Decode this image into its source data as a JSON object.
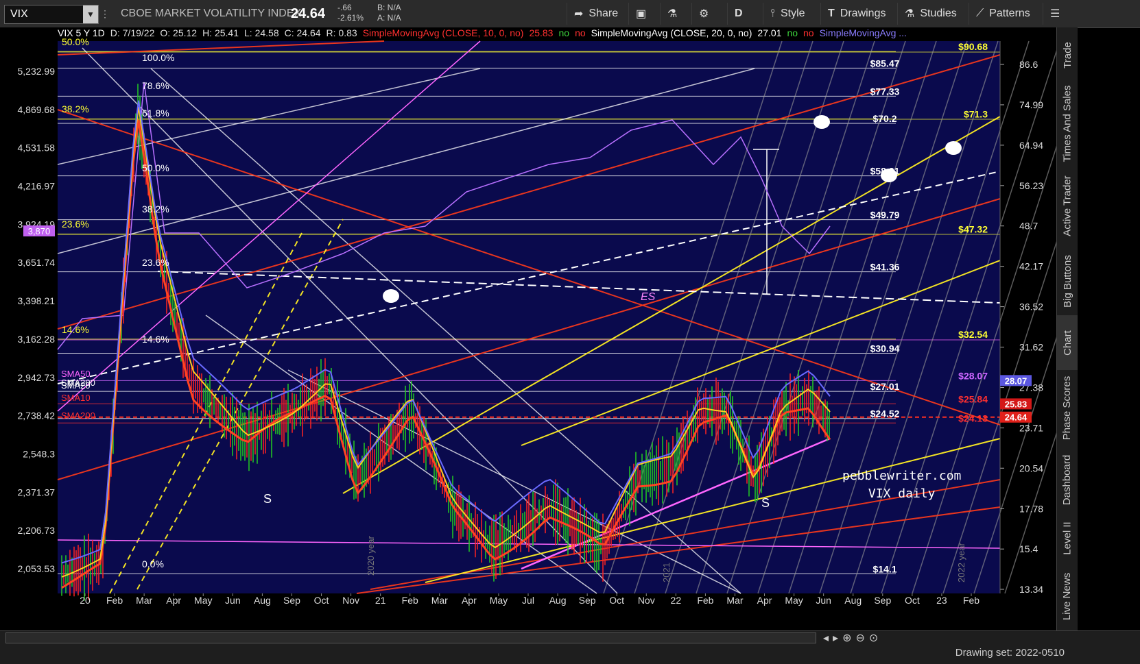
{
  "toolbar": {
    "symbol": "VIX",
    "name": "CBOE MARKET VOLATILITY INDEX",
    "last": "24.64",
    "change": "-.66",
    "change_pct": "-2.61%",
    "bid": "B: N/A",
    "ask": "A: N/A",
    "share": "Share",
    "period_label": "D",
    "style": "Style",
    "drawings": "Drawings",
    "studies": "Studies",
    "patterns": "Patterns"
  },
  "header": {
    "title": "VIX 5 Y 1D",
    "date": "D: 7/19/22",
    "open": "O: 25.12",
    "high": "H: 25.41",
    "low": "L: 24.58",
    "close": "C: 24.64",
    "range": "R: 0.83",
    "sma10": "SimpleMovingAvg (CLOSE, 10, 0, no)",
    "sma10_val": "25.83",
    "no1": "no",
    "no2": "no",
    "sma20": "SimpleMovingAvg (CLOSE, 20, 0, no)",
    "sma20_val": "27.01",
    "no3": "no",
    "no4": "no",
    "sma_more": "SimpleMovingAvg ..."
  },
  "chart_data": {
    "type": "line",
    "title": "VIX 5 Y 1D",
    "x_labels": [
      "20",
      "Feb",
      "Mar",
      "Apr",
      "May",
      "Jun",
      "Aug",
      "Sep",
      "Oct",
      "Nov",
      "21",
      "Feb",
      "Mar",
      "Apr",
      "May",
      "Jul",
      "Aug",
      "Sep",
      "Oct",
      "Nov",
      "22",
      "Feb",
      "Mar",
      "Apr",
      "May",
      "Jun",
      "Aug",
      "Sep",
      "Oct",
      "23",
      "Feb"
    ],
    "y_right_ticks": [
      86.6,
      74.99,
      64.94,
      56.23,
      48.7,
      42.17,
      36.52,
      31.62,
      27.38,
      23.71,
      20.54,
      17.78,
      15.4,
      13.34
    ],
    "y_left_ticks": [
      "5,232.99",
      "4,869.68",
      "4,531.58",
      "4,216.97",
      "3,924.19",
      "3,651.74",
      "3,398.21",
      "3,162.28",
      "2,942.73",
      "2,738.42",
      "2,548.3",
      "2,371.37",
      "2,206.73",
      "2,053.53"
    ],
    "y_scale": "log",
    "fib_left_labels": [
      "100.0%",
      "78.6%",
      "61.8%",
      "50.0%",
      "38.2%",
      "23.6%",
      "14.6%",
      "0.0%"
    ],
    "fib_far_left": [
      "50.0%",
      "38.2%",
      "23.6%",
      "14.6%"
    ],
    "level_labels": [
      "$90.68",
      "$85.47",
      "$77.33",
      "$71.3",
      "$70.2",
      "$58.21",
      "$49.79",
      "$47.32",
      "$41.36",
      "$32.54",
      "$30.94",
      "$28.07",
      "$27.01",
      "$25.84",
      "$24.52",
      "$24.13",
      "$14.1"
    ],
    "price_tags": [
      {
        "label": "28.07",
        "color": "#5b57e0"
      },
      {
        "label": "25.83",
        "color": "#d41818"
      },
      {
        "label": "24.64",
        "color": "#e0201a"
      }
    ],
    "left_tag": "3,870",
    "ma_labels": [
      "SMA50",
      "SMA200",
      "SMA20",
      "SMA10",
      "SMA200"
    ],
    "annotations": [
      "ES",
      "S",
      "S",
      "2020 year",
      "2021",
      "2022 year"
    ],
    "last_value": 24.64
  },
  "watermark": {
    "line1": "pebblewriter.com",
    "line2": "VIX daily"
  },
  "rail": [
    "Trade",
    "Times And Sales",
    "Active Trader",
    "Big Buttons",
    "Chart",
    "Phase Scores",
    "Dashboard",
    "Level II",
    "Live News"
  ],
  "footer": {
    "drawing_set": "Drawing set: 2022-0510"
  }
}
